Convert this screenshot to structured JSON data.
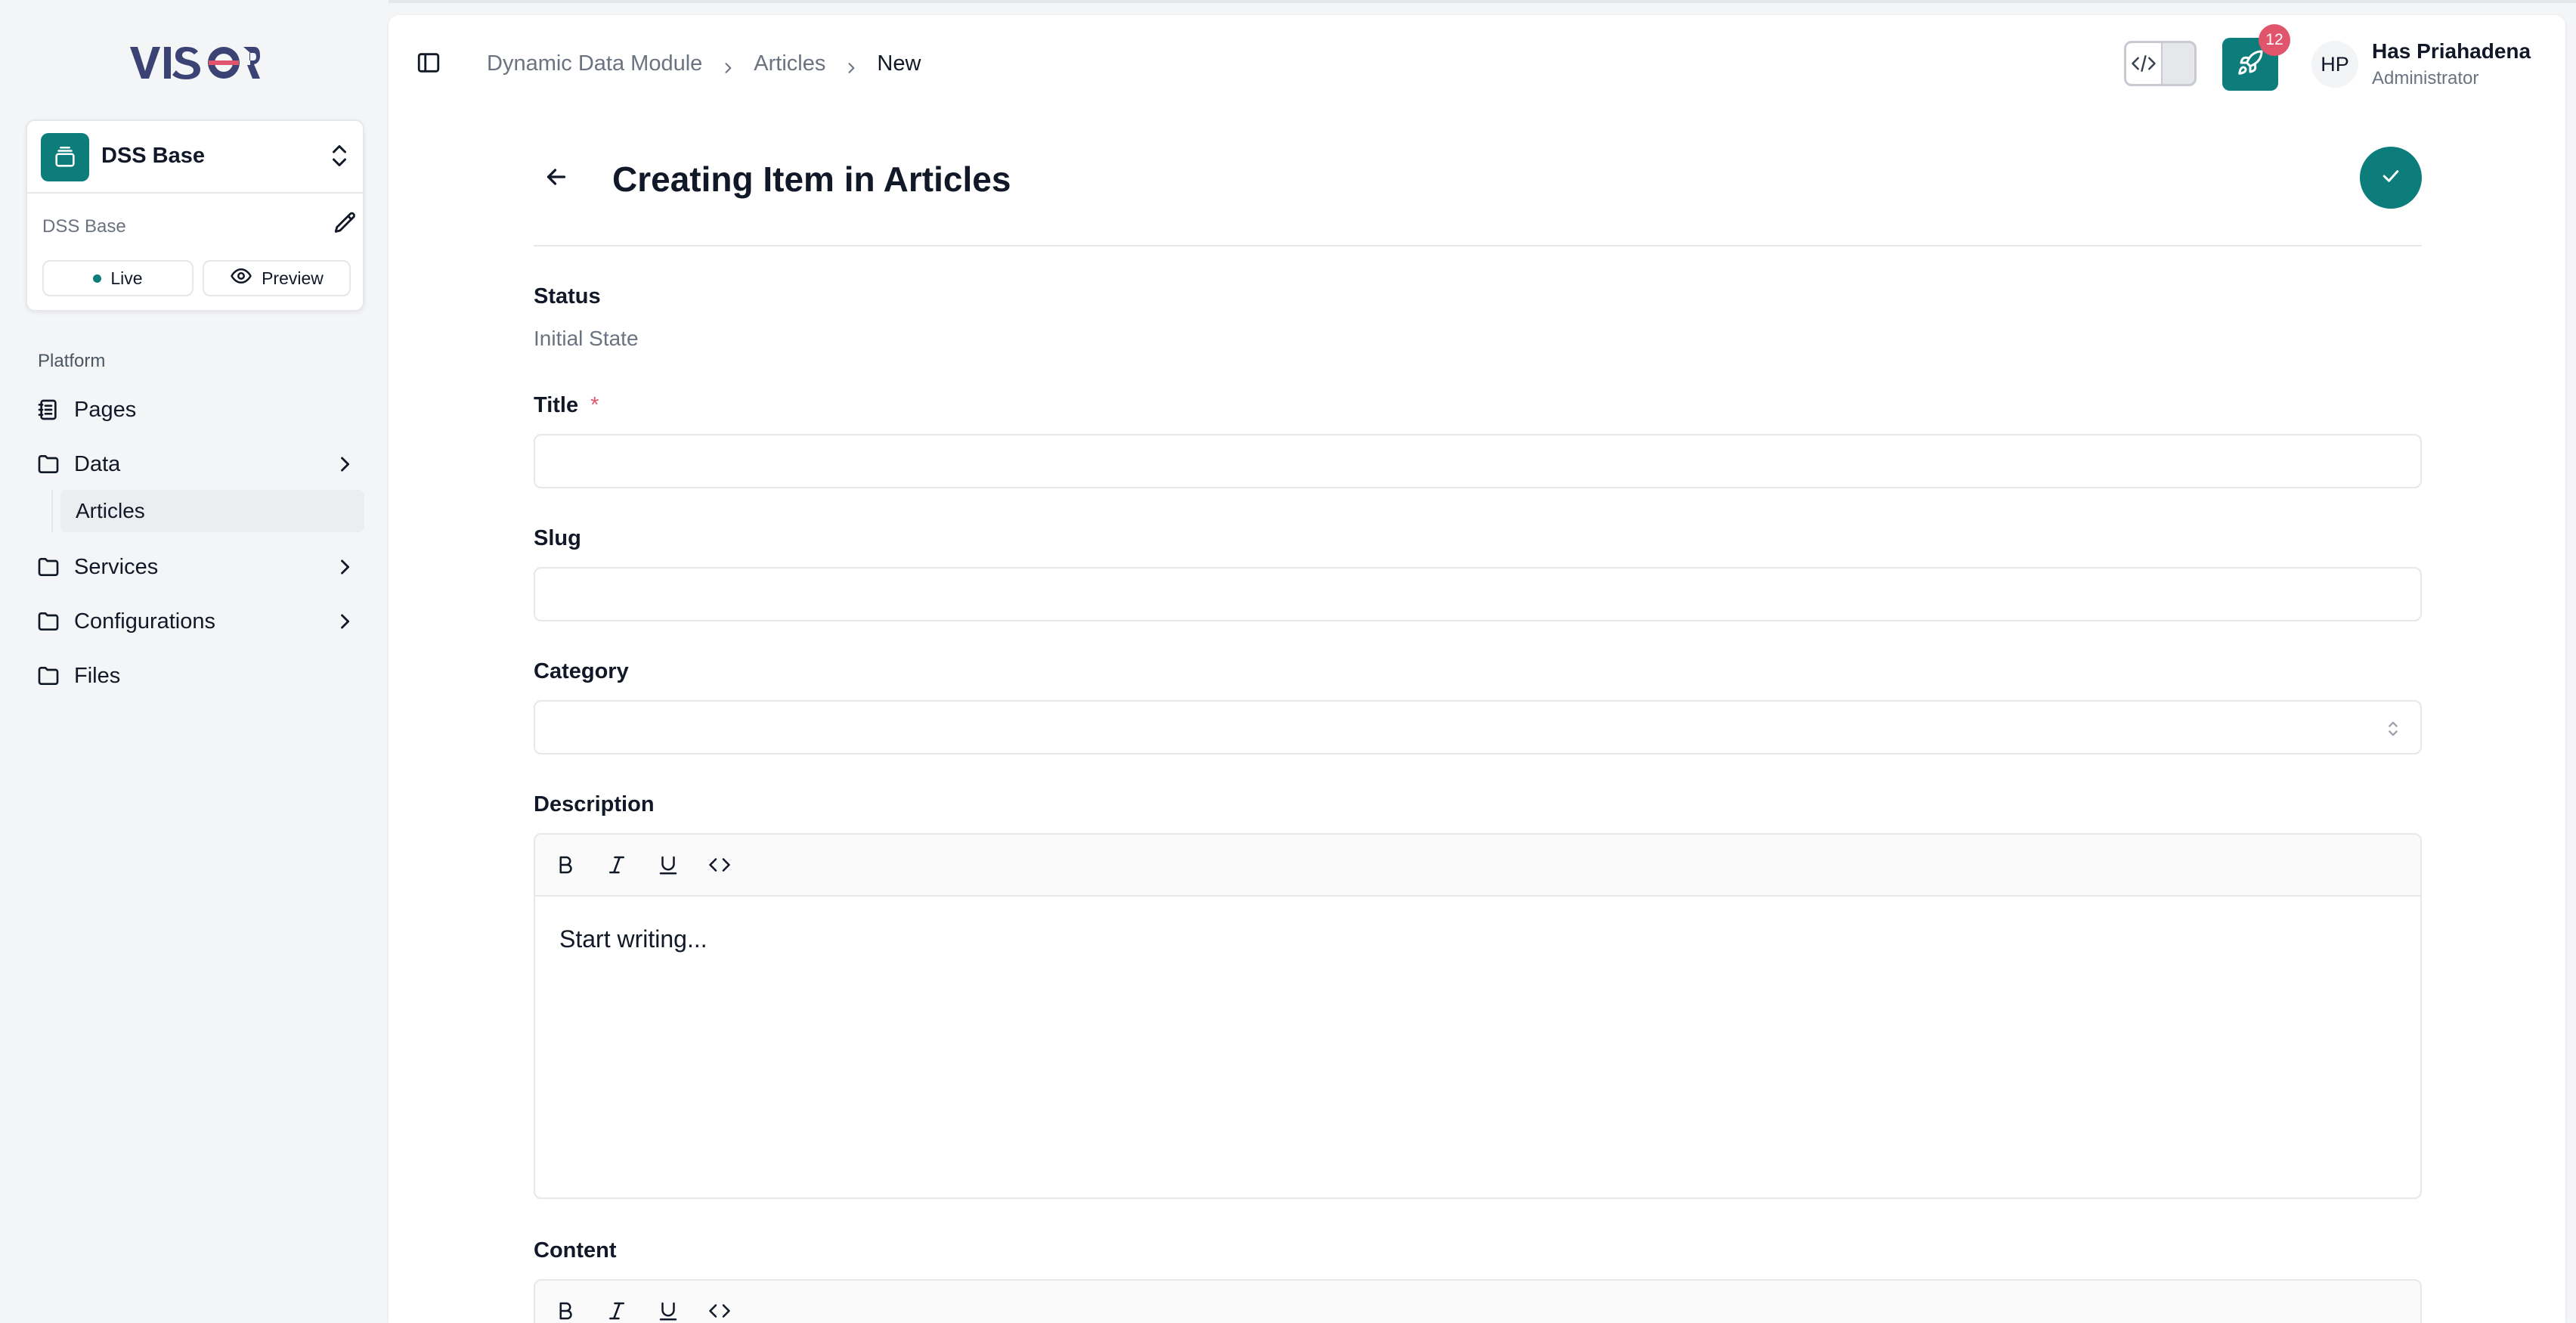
{
  "brand": {
    "logo_text": "VIS☉R"
  },
  "workspace": {
    "name": "DSS Base",
    "subtitle": "DSS Base",
    "live_label": "Live",
    "preview_label": "Preview"
  },
  "sidebar": {
    "section_label": "Platform",
    "items": [
      {
        "label": "Pages",
        "icon": "book-icon"
      },
      {
        "label": "Data",
        "icon": "folder-icon",
        "has_children": true
      },
      {
        "label": "Services",
        "icon": "folder-icon",
        "has_children": true
      },
      {
        "label": "Configurations",
        "icon": "folder-icon",
        "has_children": true
      },
      {
        "label": "Files",
        "icon": "folder-icon"
      }
    ],
    "sub_items": [
      {
        "label": "Articles"
      }
    ]
  },
  "breadcrumb": {
    "items": [
      "Dynamic Data Module",
      "Articles"
    ],
    "current": "New"
  },
  "header": {
    "notification_count": "12",
    "user_initials": "HP",
    "user_name": "Has Priahadena",
    "user_role": "Administrator"
  },
  "page": {
    "title": "Creating Item in Articles"
  },
  "form": {
    "status_label": "Status",
    "status_value": "Initial State",
    "title_label": "Title",
    "required_mark": "*",
    "title_value": "",
    "slug_label": "Slug",
    "slug_value": "",
    "category_label": "Category",
    "category_value": "",
    "description_label": "Description",
    "description_placeholder": "Start writing...",
    "content_label": "Content"
  },
  "colors": {
    "accent": "#0d7d7b",
    "badge": "#e0556b"
  }
}
